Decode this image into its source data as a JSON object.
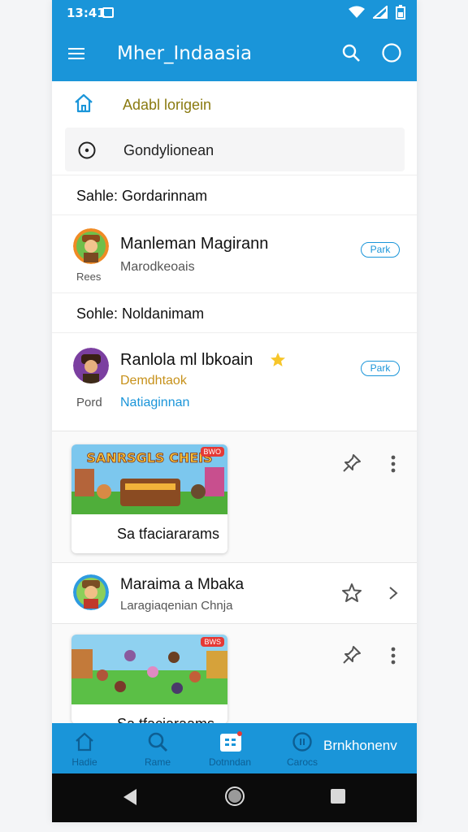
{
  "status": {
    "time": "13:41"
  },
  "app": {
    "title": "Mher_Indaasia"
  },
  "nav_rows": {
    "home_label": "Adabl lorigein",
    "search_label": "Gondylionean"
  },
  "sections": [
    {
      "label": "Sahle: Gordarinnam"
    },
    {
      "label": "Sohle: Noldanimam"
    }
  ],
  "users": [
    {
      "name": "Manleman Magirann",
      "subtitle": "Marodkeoais",
      "small_label": "Rees",
      "pill": "Park"
    },
    {
      "name": "Ranlola ml lbkoain",
      "subtitle": "Demdhtaok",
      "small_label": "Pord",
      "link": "Natiaginnan",
      "pill": "Park"
    }
  ],
  "feed": {
    "card1": {
      "banner": "SANRSGLS CHEIS",
      "badge": "BWO",
      "caption": "Sa tfaciararams"
    },
    "list_item": {
      "name": "Maraima a Mbaka",
      "subtitle": "Laragiaqenian Chnja"
    },
    "card2": {
      "badge": "BWS",
      "caption": "Sa tfaciaraams"
    }
  },
  "bottom_nav": {
    "items": [
      {
        "label": "Hadie",
        "icon": "home-icon"
      },
      {
        "label": "Rame",
        "icon": "search-icon"
      },
      {
        "label": "Dotnndan",
        "icon": "grid-icon"
      },
      {
        "label": "Carocs",
        "icon": "circle-icon"
      }
    ],
    "active_label": "Brnkhonenv"
  },
  "colors": {
    "accent": "#1a95d9",
    "gold": "#8a7a10",
    "orange": "#c7911a"
  }
}
